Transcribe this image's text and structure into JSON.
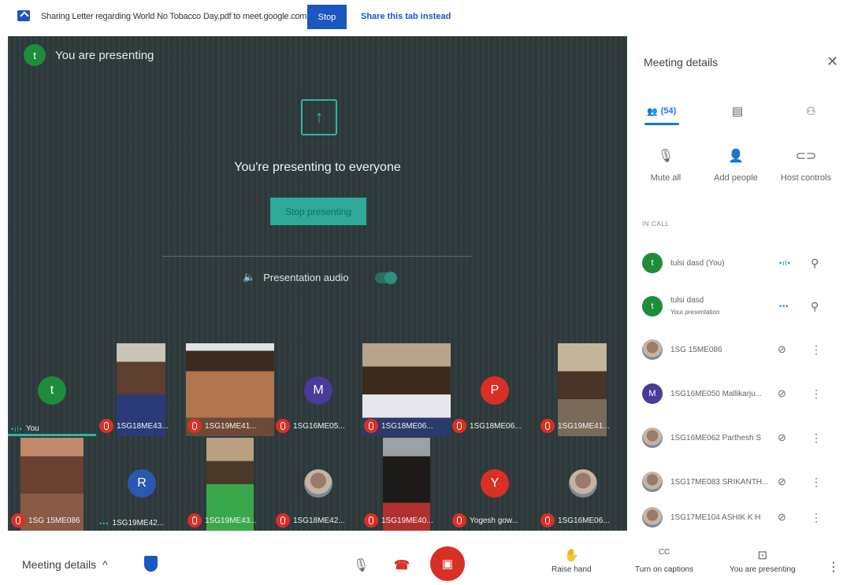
{
  "share_bar": {
    "text": "Sharing Letter regarding World No Tobacco Day.pdf to meet.google.com",
    "stop_label": "Stop",
    "share_tab_label": "Share this tab instead"
  },
  "stage": {
    "presenting_initial": "t",
    "presenting_label": "You are presenting",
    "present_icon": "↑",
    "title": "You're presenting to everyone",
    "stop_button": "Stop presenting",
    "audio_icon": "🔈",
    "audio_label": "Presentation audio"
  },
  "tiles": [
    {
      "name": "You",
      "initial": "t",
      "muted": false
    },
    {
      "name": "1SG18ME43...",
      "muted": true
    },
    {
      "name": "1SG19ME41...",
      "muted": true
    },
    {
      "name": "1SG16ME05...",
      "initial": "M",
      "muted": true
    },
    {
      "name": "1SG18ME06...",
      "muted": true
    },
    {
      "name": "1SG18ME06...",
      "initial": "P",
      "muted": true
    },
    {
      "name": "1SG19ME41...",
      "muted": true
    },
    {
      "name": "1SG 15ME086",
      "muted": true
    },
    {
      "name": "1SG19ME42...",
      "initial": "R",
      "muted": false
    },
    {
      "name": "1SG19ME43...",
      "muted": true
    },
    {
      "name": "1SG18ME42...",
      "muted": true
    },
    {
      "name": "1SG19ME40...",
      "muted": true
    },
    {
      "name": "Yogesh gow...",
      "initial": "Y",
      "muted": true
    },
    {
      "name": "1SG16ME06...",
      "muted": true
    }
  ],
  "panel": {
    "title": "Meeting details",
    "close_icon": "✕",
    "people_count": "(54)",
    "tools": {
      "mute_all": "Mute all",
      "add_people": "Add people",
      "host_controls": "Host controls"
    },
    "in_call_label": "IN CALL",
    "people": [
      {
        "name": "tulsi dasd (You)",
        "initial": "t"
      },
      {
        "name": "tulsi dasd",
        "sub": "Your presentation",
        "initial": "t"
      },
      {
        "name": "1SG 15ME086"
      },
      {
        "name": "1SG16ME050 Mallikarju...",
        "initial": "M"
      },
      {
        "name": "1SG16ME062 Parthesh S"
      },
      {
        "name": "1SG17ME083 SRIKANTH..."
      },
      {
        "name": "1SG17ME104 ASHIK K H"
      }
    ]
  },
  "bottom_bar": {
    "meeting_details": "Meeting details",
    "chevron": "^",
    "raise_hand": "Raise hand",
    "captions": "Turn on captions",
    "captions_icon": "CC",
    "presenting": "You are presenting",
    "more": "⋮"
  },
  "colors": {
    "accent": "#1a73e8",
    "share_blue": "#1a57c0",
    "teal": "#33b3a5",
    "danger": "#d93025",
    "stage_bg": "#2e3a3c"
  }
}
